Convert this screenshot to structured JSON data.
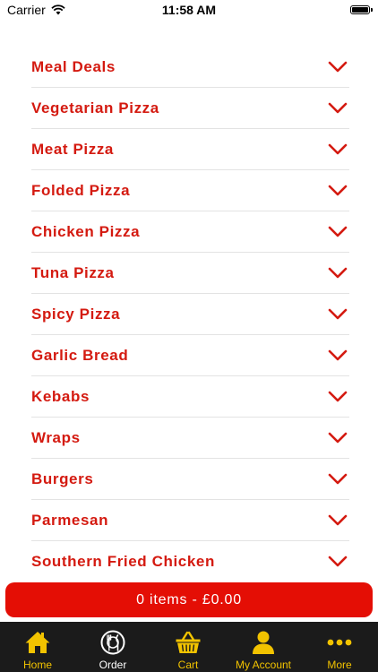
{
  "status_bar": {
    "carrier": "Carrier",
    "time": "11:58 AM"
  },
  "menu": {
    "items": [
      {
        "label": "Meal Deals"
      },
      {
        "label": "Vegetarian Pizza"
      },
      {
        "label": "Meat Pizza"
      },
      {
        "label": "Folded Pizza"
      },
      {
        "label": "Chicken Pizza"
      },
      {
        "label": "Tuna Pizza"
      },
      {
        "label": "Spicy Pizza"
      },
      {
        "label": "Garlic Bread"
      },
      {
        "label": "Kebabs"
      },
      {
        "label": "Wraps"
      },
      {
        "label": "Burgers"
      },
      {
        "label": "Parmesan"
      },
      {
        "label": "Southern Fried Chicken"
      }
    ]
  },
  "cart_bar": {
    "label": "0 items - £0.00"
  },
  "tab_bar": {
    "tabs": [
      {
        "label": "Home",
        "icon": "home-icon"
      },
      {
        "label": "Order",
        "icon": "order-icon",
        "active": true
      },
      {
        "label": "Cart",
        "icon": "basket-icon"
      },
      {
        "label": "My Account",
        "icon": "user-icon"
      },
      {
        "label": "More",
        "icon": "more-dots-icon"
      }
    ]
  },
  "colors": {
    "accent": "#d41a10",
    "cart_bar": "#e40e05",
    "tab_bar": "#1b1b1b",
    "tab_icon": "#f2c300"
  }
}
